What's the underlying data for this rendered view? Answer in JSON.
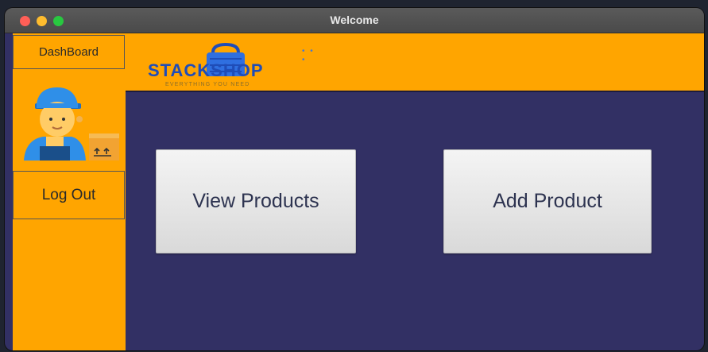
{
  "window": {
    "title": "Welcome"
  },
  "sidebar": {
    "dashboard_label": "DashBoard",
    "logout_label": "Log Out"
  },
  "header": {
    "logo_text": "STACKSHOP",
    "logo_tagline": "EVERYTHING YOU NEED",
    "logo_dots": "• • •"
  },
  "main": {
    "view_products_label": "View Products",
    "add_product_label": "Add Product"
  },
  "icons": {
    "avatar": "delivery-worker-avatar-icon",
    "logo": "shopping-basket-logo-icon"
  },
  "colors": {
    "accent_orange": "#ffa500",
    "content_bg": "#323064",
    "logo_blue": "#1f4db8",
    "button_bg": "#e6e6e6",
    "button_text": "#2d3350"
  }
}
